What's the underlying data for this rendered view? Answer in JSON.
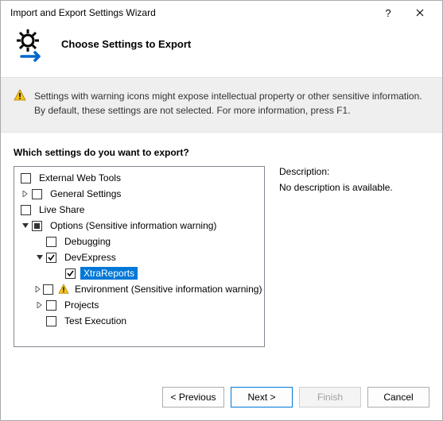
{
  "window": {
    "title": "Import and Export Settings Wizard",
    "help_label": "?",
    "close_label": "✕"
  },
  "header": {
    "heading": "Choose Settings to Export"
  },
  "warning": {
    "text": "Settings with warning icons might expose intellectual property or other sensitive information. By default, these settings are not selected. For more information, press F1."
  },
  "tree": {
    "prompt": "Which settings do you want to export?",
    "items": {
      "external_web_tools": "External Web Tools",
      "general_settings": "General Settings",
      "live_share": "Live Share",
      "options": "Options (Sensitive information warning)",
      "debugging": "Debugging",
      "devexpress": "DevExpress",
      "xtrareports": "XtraReports",
      "environment": "Environment (Sensitive information warning)",
      "projects": "Projects",
      "test_execution": "Test Execution"
    }
  },
  "description": {
    "heading": "Description:",
    "body": "No description is available."
  },
  "buttons": {
    "previous": "< Previous",
    "next": "Next >",
    "finish": "Finish",
    "cancel": "Cancel"
  }
}
